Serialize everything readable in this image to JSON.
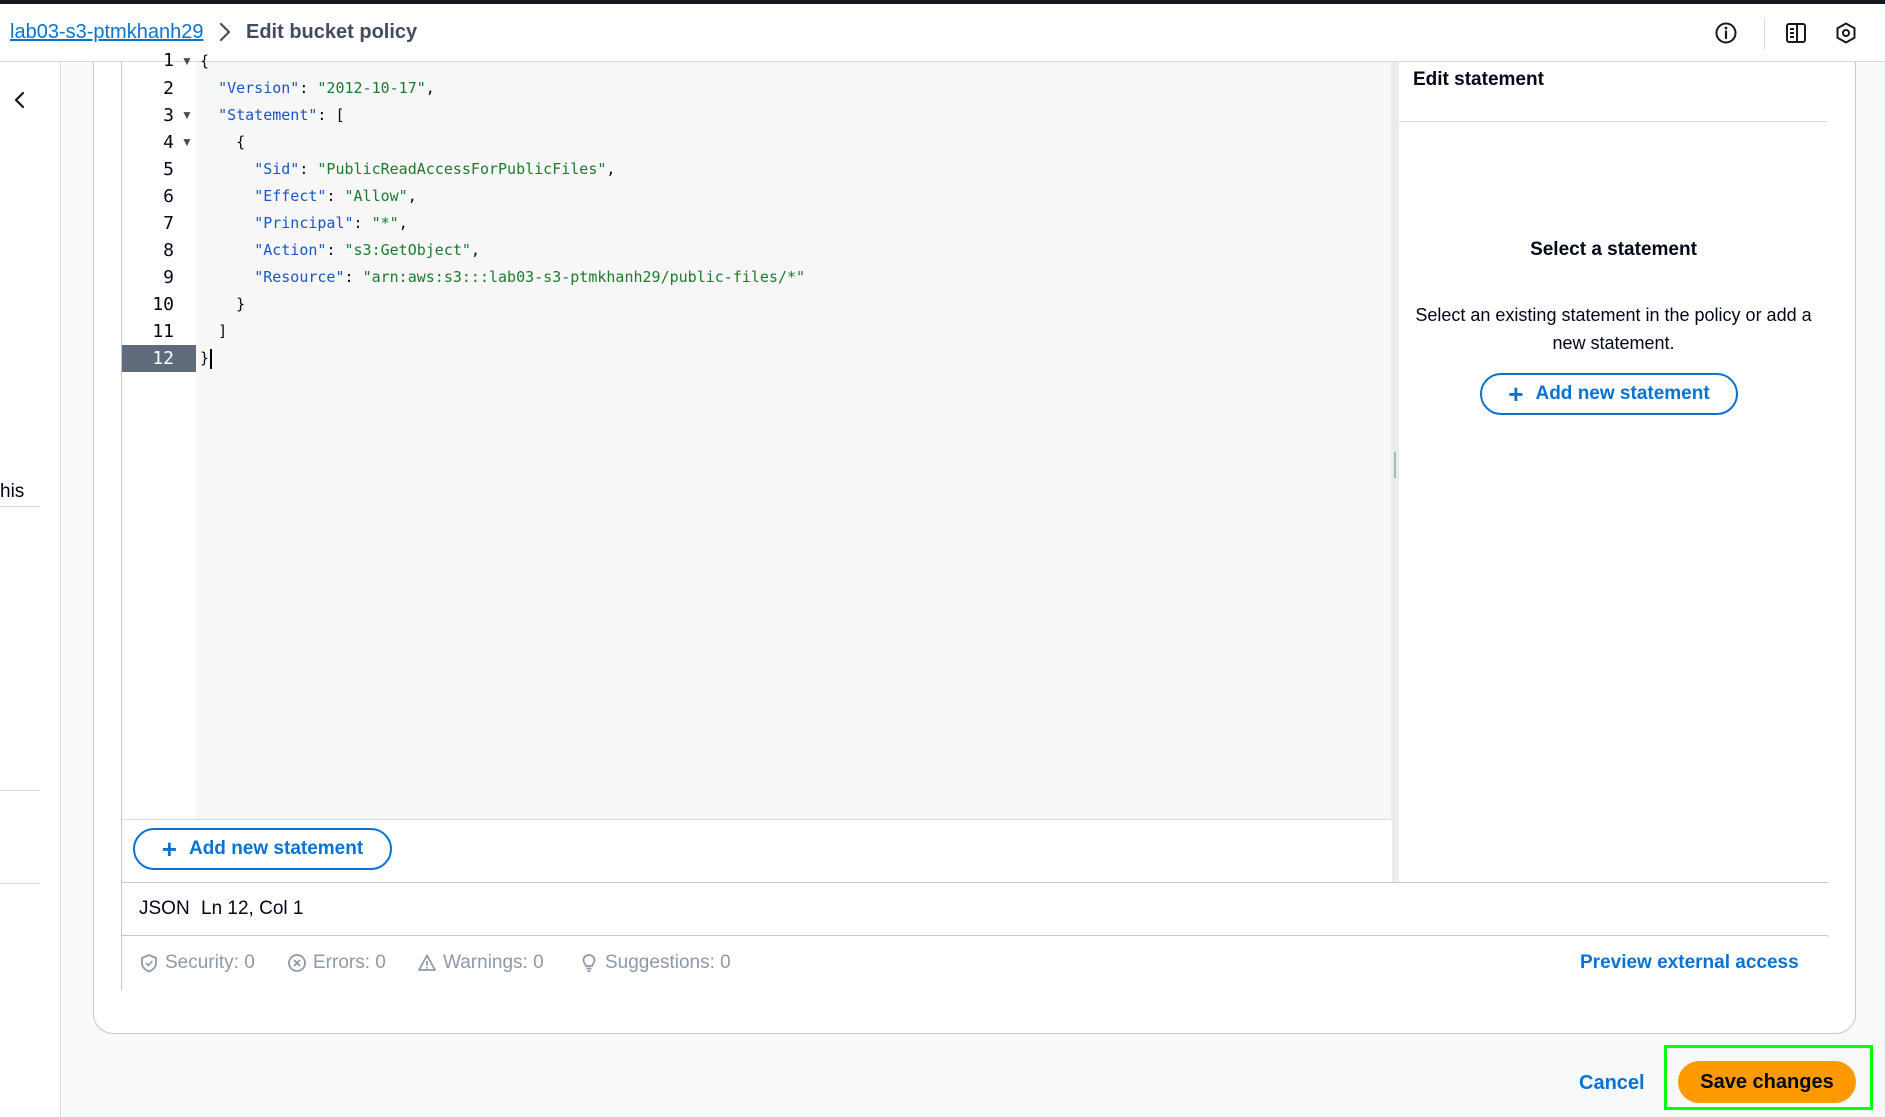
{
  "breadcrumb": {
    "bucket": "lab03-s3-ptmkhanh29",
    "current": "Edit bucket policy"
  },
  "header_icons": [
    "info-icon",
    "panel-icon",
    "hexagon-icon"
  ],
  "left_rail": {
    "truncated_text": "his"
  },
  "editor": {
    "line_numbers": [
      "1",
      "2",
      "3",
      "4",
      "5",
      "6",
      "7",
      "8",
      "9",
      "10",
      "11",
      "12"
    ],
    "active_line": "12",
    "tokens": {
      "open_brace": "{",
      "version_key": "\"Version\"",
      "version_val": "\"2012-10-17\"",
      "statement_key": "\"Statement\"",
      "open_bracket": "[",
      "stmt_open": "{",
      "sid_key": "\"Sid\"",
      "sid_val": "\"PublicReadAccessForPublicFiles\"",
      "effect_key": "\"Effect\"",
      "effect_val": "\"Allow\"",
      "principal_key": "\"Principal\"",
      "principal_val": "\"*\"",
      "action_key": "\"Action\"",
      "action_val": "\"s3:GetObject\"",
      "resource_key": "\"Resource\"",
      "resource_val": "\"arn:aws:s3:::lab03-s3-ptmkhanh29/public-files/*\"",
      "stmt_close": "}",
      "close_bracket": "]",
      "close_brace": "}"
    },
    "add_statement_label": "Add new statement"
  },
  "side_panel": {
    "title": "Edit statement",
    "select_title": "Select a statement",
    "select_description": "Select an existing statement in the policy or add a new statement.",
    "add_statement_label": "Add new statement"
  },
  "status": {
    "language": "JSON",
    "position": "Ln 12, Col 1"
  },
  "checks": {
    "security": "Security: 0",
    "errors": "Errors: 0",
    "warnings": "Warnings: 0",
    "suggestions": "Suggestions: 0",
    "preview_link": "Preview external access"
  },
  "footer": {
    "cancel_label": "Cancel",
    "save_label": "Save changes"
  },
  "colors": {
    "link": "#0972d3",
    "primary_button": "#ff9900",
    "highlight": "#00ff00",
    "json_key": "#1a56c7",
    "json_string": "#1d7a2c"
  }
}
